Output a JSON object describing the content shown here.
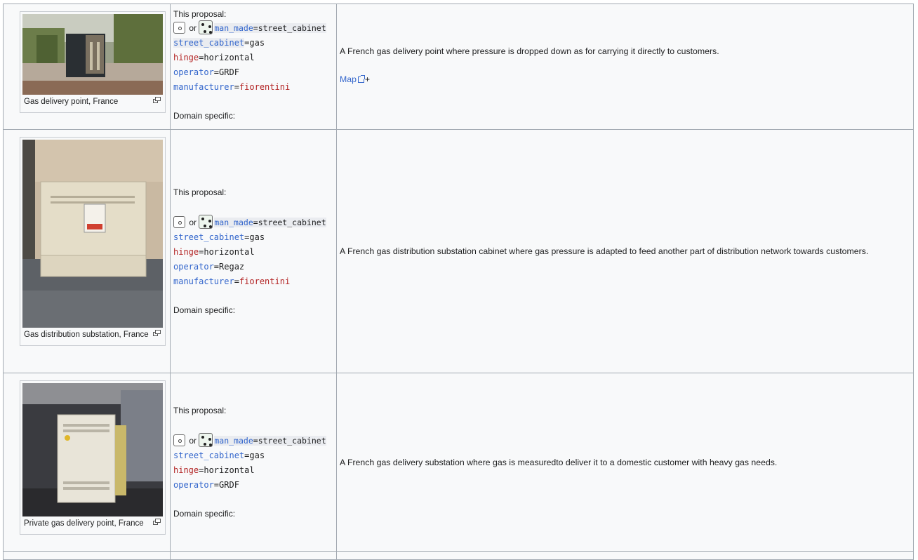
{
  "rows": [
    {
      "caption": "Gas delivery point, France",
      "proposal_label": "This proposal:",
      "or_text": "or",
      "tags": [
        {
          "key": "man_made",
          "value": "street_cabinet",
          "value_style": "plain"
        },
        {
          "key": "street_cabinet",
          "value": "gas",
          "value_style": "plain"
        },
        {
          "key": "hinge",
          "value": "horizontal",
          "value_style": "plain",
          "key_style": "red"
        },
        {
          "key": "operator",
          "value": "GRDF",
          "value_style": "plain"
        },
        {
          "key": "manufacturer",
          "value": "fiorentini",
          "value_style": "red"
        }
      ],
      "domain_label": "Domain specific:",
      "description": "A French gas delivery point where pressure is dropped down as for carrying it directly to customers.",
      "map_link": "Map",
      "map_plus": "+"
    },
    {
      "caption": "Gas distribution substation, France",
      "proposal_label": "This proposal:",
      "or_text": "or",
      "tags": [
        {
          "key": "man_made",
          "value": "street_cabinet"
        },
        {
          "key": "street_cabinet",
          "value": "gas"
        },
        {
          "key": "hinge",
          "value": "horizontal"
        },
        {
          "key": "operator",
          "value": "Regaz"
        },
        {
          "key": "manufacturer",
          "value": "fiorentini"
        }
      ],
      "domain_label": "Domain specific:",
      "description": "A French gas distribution substation cabinet where gas pressure is adapted to feed another part of distribution network towards customers."
    },
    {
      "caption": "Private gas delivery point, France",
      "proposal_label": "This proposal:",
      "or_text": "or",
      "tags": [
        {
          "key": "man_made",
          "value": "street_cabinet"
        },
        {
          "key": "street_cabinet",
          "value": "gas"
        },
        {
          "key": "hinge",
          "value": "horizontal"
        },
        {
          "key": "operator",
          "value": "GRDF"
        }
      ],
      "domain_label": "Domain specific:",
      "description": "A French gas delivery substation where gas is measuredto deliver it to a domestic customer with heavy gas needs."
    }
  ]
}
